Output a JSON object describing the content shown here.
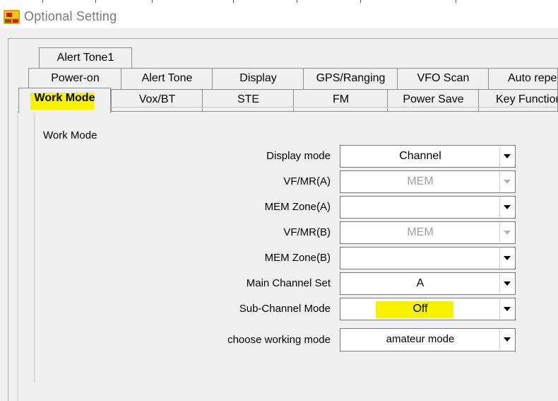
{
  "window": {
    "title": "Optional Setting",
    "icon": "app-radio-icon"
  },
  "tabs": {
    "row1": [
      {
        "label": "Alert Tone1"
      }
    ],
    "row2": [
      {
        "label": "Power-on"
      },
      {
        "label": "Alert Tone"
      },
      {
        "label": "Display"
      },
      {
        "label": "GPS/Ranging"
      },
      {
        "label": "VFO Scan"
      },
      {
        "label": "Auto repeat"
      }
    ],
    "row3": [
      {
        "label": "Work Mode",
        "selected": true
      },
      {
        "label": "Vox/BT"
      },
      {
        "label": "STE"
      },
      {
        "label": "FM"
      },
      {
        "label": "Power Save"
      },
      {
        "label": "Key Function"
      }
    ]
  },
  "group": {
    "title": "Work Mode",
    "fields": [
      {
        "label": "Display mode",
        "value": "Channel",
        "enabled": true
      },
      {
        "label": "VF/MR(A)",
        "value": "MEM",
        "enabled": false
      },
      {
        "label": "MEM Zone(A)",
        "value": "",
        "enabled": true
      },
      {
        "label": "VF/MR(B)",
        "value": "MEM",
        "enabled": false
      },
      {
        "label": "MEM Zone(B)",
        "value": "",
        "enabled": true
      },
      {
        "label": "Main Channel Set",
        "value": "A",
        "enabled": true
      },
      {
        "label": "Sub-Channel Mode",
        "value": "Off",
        "enabled": true,
        "highlighted": true
      },
      {
        "label": "choose working mode",
        "value": "amateur mode",
        "enabled": true
      }
    ]
  },
  "colors": {
    "highlight": "#f6f200",
    "dialog_bg": "#f0f0f0",
    "disabled_text": "#a0a0a0"
  }
}
